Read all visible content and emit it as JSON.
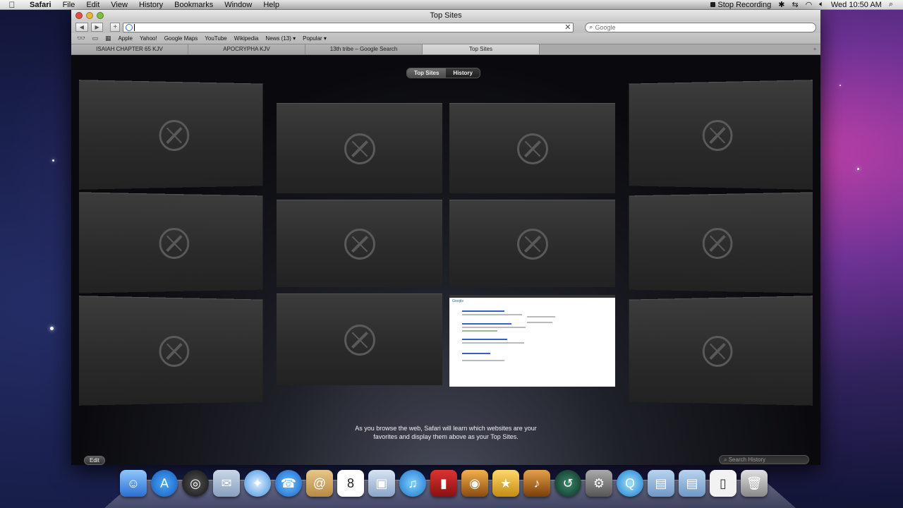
{
  "menubar": {
    "app": "Safari",
    "items": [
      "File",
      "Edit",
      "View",
      "History",
      "Bookmarks",
      "Window",
      "Help"
    ],
    "stop_recording": "Stop Recording",
    "clock": "Wed 10:50 AM"
  },
  "window": {
    "title": "Top Sites"
  },
  "toolbar": {
    "search_placeholder": "Google"
  },
  "bookmarks": [
    "Apple",
    "Yahoo!",
    "Google Maps",
    "YouTube",
    "Wikipedia",
    "News (13) ▾",
    "Popular ▾"
  ],
  "tabs": [
    {
      "label": "ISAIAH CHAPTER 65 KJV"
    },
    {
      "label": "APOCRYPHA KJV"
    },
    {
      "label": "13th tribe – Google Search"
    },
    {
      "label": "Top Sites"
    }
  ],
  "topsites": {
    "seg_top_sites": "Top Sites",
    "seg_history": "History",
    "message_line1": "As you browse the web, Safari will learn which websites are your",
    "message_line2": "favorites and display them above as your Top Sites.",
    "edit_label": "Edit",
    "search_history_placeholder": "Search History"
  },
  "colors": {
    "accent": "#2a6fd1",
    "content_bg": "#0a0a0e"
  }
}
